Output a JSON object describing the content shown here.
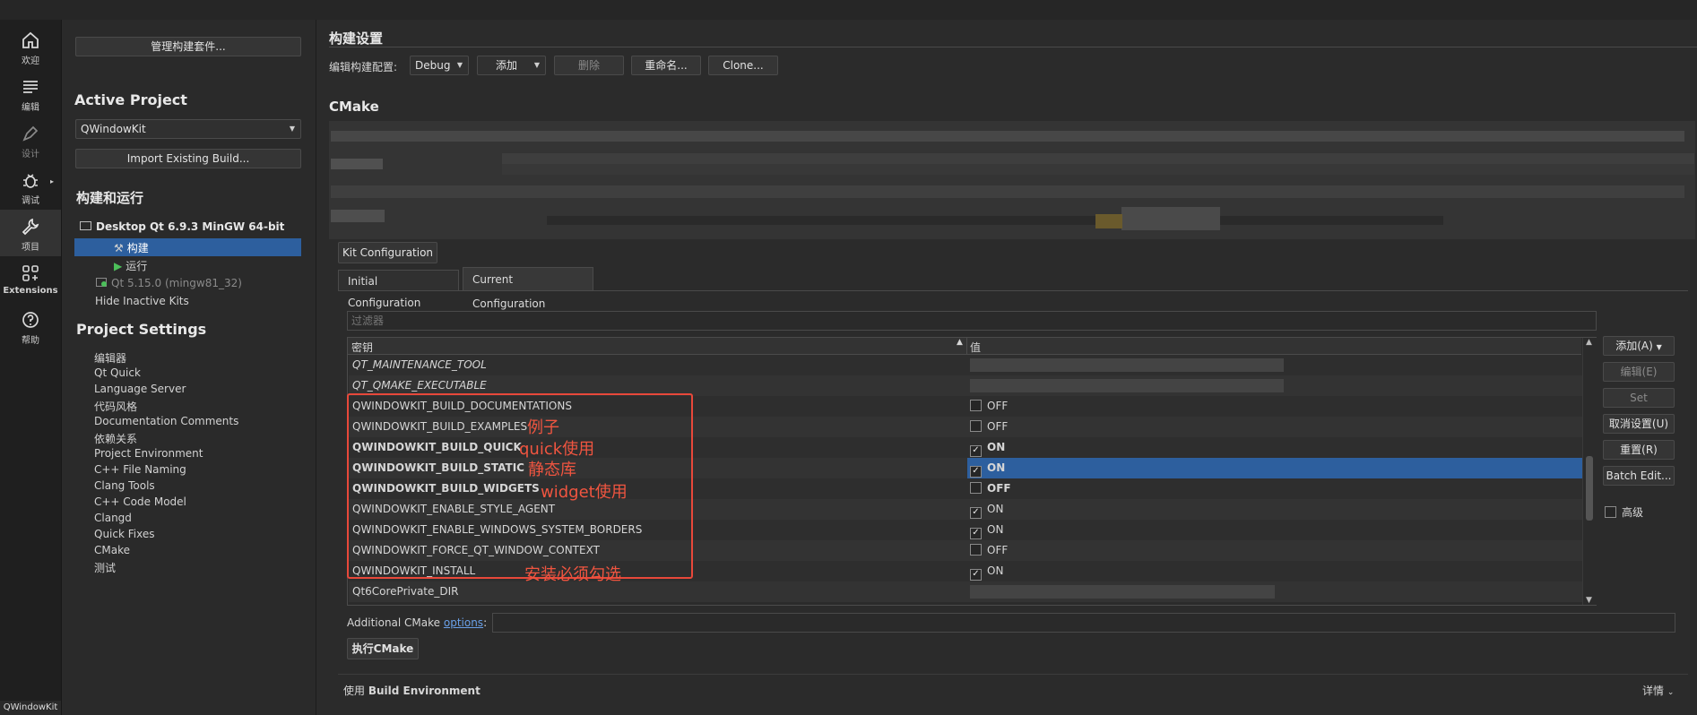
{
  "modebar": {
    "items": [
      {
        "label": "欢迎",
        "icon": "home-icon"
      },
      {
        "label": "编辑",
        "icon": "edit-lines-icon"
      },
      {
        "label": "设计",
        "icon": "pen-icon"
      },
      {
        "label": "调试",
        "icon": "bug-icon"
      },
      {
        "label": "项目",
        "icon": "wrench-icon"
      },
      {
        "label": "Extensions",
        "icon": "extensions-grid-icon"
      },
      {
        "label": "帮助",
        "icon": "help-icon"
      }
    ],
    "footer": "QWindowKit"
  },
  "sidebar": {
    "manage_kits": "管理构建套件...",
    "active_project_title": "Active Project",
    "project_combo": "QWindowKit",
    "import_build": "Import Existing Build...",
    "build_run_title": "构建和运行",
    "kit_name": "Desktop Qt 6.9.3 MinGW 64-bit",
    "build_item": "构建",
    "run_item": "运行",
    "inactive_kit": "Qt 5.15.0 (mingw81_32)",
    "hide_inactive": "Hide Inactive Kits",
    "project_settings_title": "Project Settings",
    "settings_items": [
      "编辑器",
      "Qt Quick",
      "Language Server",
      "代码风格",
      "Documentation Comments",
      "依赖关系",
      "Project Environment",
      "C++ File Naming",
      "Clang Tools",
      "C++ Code Model",
      "Clangd",
      "Quick Fixes",
      "CMake",
      "测试"
    ]
  },
  "main": {
    "title": "构建设置",
    "edit_config_label": "编辑构建配置:",
    "config_combo": "Debug",
    "add_combo": "添加",
    "delete_button": "删除",
    "rename_button": "重命名...",
    "clone_button": "Clone...",
    "cmake_title": "CMake",
    "kit_config_button": "Kit Configuration",
    "tabs": [
      "Initial Configuration",
      "Current Configuration"
    ],
    "filter_placeholder": "过滤器",
    "table": {
      "col_key": "密钥",
      "col_value": "值",
      "rows": [
        {
          "key": "QT_MAINTENANCE_TOOL",
          "value": "",
          "italic": true,
          "checkbox": false
        },
        {
          "key": "QT_QMAKE_EXECUTABLE",
          "value": "",
          "italic": true,
          "checkbox": false
        },
        {
          "key": "QWINDOWKIT_BUILD_DOCUMENTATIONS",
          "value": "OFF",
          "checked": false,
          "bold": false,
          "checkbox": true
        },
        {
          "key": "QWINDOWKIT_BUILD_EXAMPLES",
          "value": "OFF",
          "checked": false,
          "bold": false,
          "checkbox": true
        },
        {
          "key": "QWINDOWKIT_BUILD_QUICK",
          "value": "ON",
          "checked": true,
          "bold": true,
          "checkbox": true
        },
        {
          "key": "QWINDOWKIT_BUILD_STATIC",
          "value": "ON",
          "checked": true,
          "bold": true,
          "checkbox": true,
          "selected": true
        },
        {
          "key": "QWINDOWKIT_BUILD_WIDGETS",
          "value": "OFF",
          "checked": false,
          "bold": true,
          "checkbox": true
        },
        {
          "key": "QWINDOWKIT_ENABLE_STYLE_AGENT",
          "value": "ON",
          "checked": true,
          "bold": false,
          "checkbox": true
        },
        {
          "key": "QWINDOWKIT_ENABLE_WINDOWS_SYSTEM_BORDERS",
          "value": "ON",
          "checked": true,
          "bold": false,
          "checkbox": true
        },
        {
          "key": "QWINDOWKIT_FORCE_QT_WINDOW_CONTEXT",
          "value": "OFF",
          "checked": false,
          "bold": false,
          "checkbox": true
        },
        {
          "key": "QWINDOWKIT_INSTALL",
          "value": "ON",
          "checked": true,
          "bold": false,
          "checkbox": true
        },
        {
          "key": "Qt6CorePrivate_DIR",
          "value": "",
          "italic": false,
          "checkbox": false
        }
      ]
    },
    "right_buttons": {
      "add": "添加(A)",
      "edit": "编辑(E)",
      "set": "Set",
      "unset": "取消设置(U)",
      "reset": "重置(R)",
      "batch": "Batch Edit...",
      "advanced": "高级"
    },
    "additional_options_prefix": "Additional CMake ",
    "additional_options_link": "options",
    "additional_options_suffix": ":",
    "run_cmake": "执行CMake",
    "build_env_prefix": "使用 ",
    "build_env_bold": "Build Environment",
    "details": "详情"
  },
  "annotations": {
    "examples": "例子",
    "quick": "quick使用",
    "static": "静态库",
    "widget": "widget使用",
    "install": "安装必须勾选"
  },
  "colors": {
    "selection": "#2d5f9e",
    "annotation": "#e8483a",
    "link": "#6aa0e8"
  }
}
